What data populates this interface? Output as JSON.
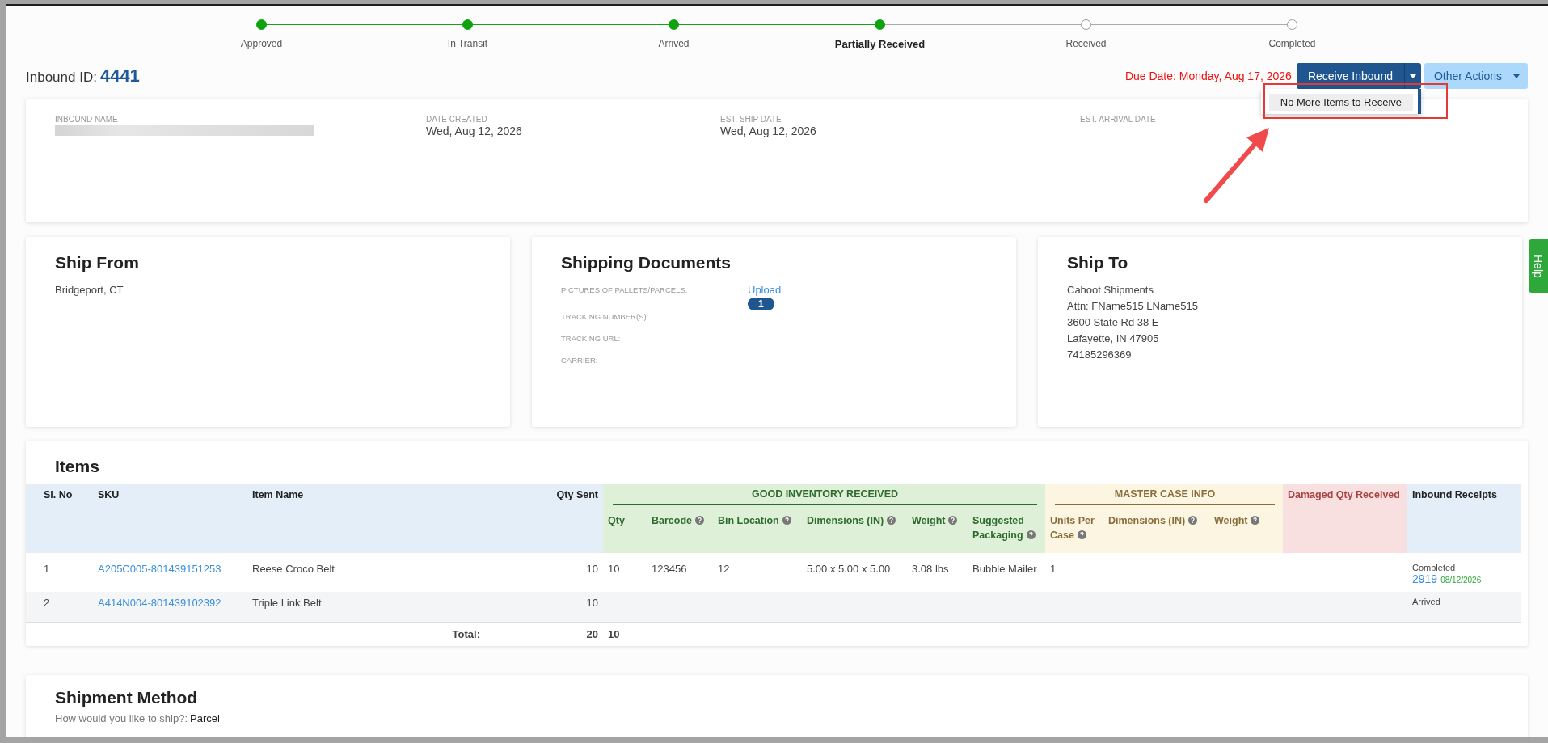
{
  "steps": [
    {
      "label": "Approved",
      "done": true,
      "selected": false
    },
    {
      "label": "In Transit",
      "done": true,
      "selected": false
    },
    {
      "label": "Arrived",
      "done": true,
      "selected": false
    },
    {
      "label": "Partially Received",
      "done": true,
      "selected": true
    },
    {
      "label": "Received",
      "done": false,
      "selected": false
    },
    {
      "label": "Completed",
      "done": false,
      "selected": false
    }
  ],
  "inbound": {
    "label": "Inbound ID:",
    "id": "4441"
  },
  "due_date": "Due Date: Monday, Aug 17, 2026",
  "receive_button": "Receive Inbound",
  "other_actions_button": "Other Actions",
  "dropdown_menu": {
    "items": [
      "No More Items to Receive"
    ]
  },
  "summary": {
    "fields": [
      {
        "label": "INBOUND NAME",
        "kind": "redacted"
      },
      {
        "label": "DATE CREATED",
        "kind": "text",
        "value": "Wed, Aug 12, 2026"
      },
      {
        "label": "EST. SHIP DATE",
        "kind": "text",
        "value": "Wed, Aug 12, 2026"
      },
      {
        "label": "EST. ARRIVAL DATE",
        "kind": "text"
      }
    ]
  },
  "ship_from": {
    "title": "Ship From",
    "lines": [
      "Bridgeport, CT"
    ]
  },
  "shipping_documents": {
    "title": "Shipping Documents",
    "fields": [
      {
        "label": "PICTURES OF PALLETS/PARCELS:",
        "link": "Upload",
        "badge": "1"
      },
      {
        "label": "TRACKING NUMBER(S):"
      },
      {
        "label": "TRACKING URL:"
      },
      {
        "label": "CARRIER:"
      }
    ]
  },
  "ship_to": {
    "title": "Ship To",
    "lines": [
      "Cahoot Shipments",
      "Attn: FName515 LName515",
      "3600 State Rd 38 E",
      "Lafayette, IN 47905",
      "74185296369"
    ]
  },
  "items": {
    "title": "Items",
    "header": [
      {
        "label": "Sl. No",
        "kind": "base"
      },
      {
        "label": "SKU",
        "kind": "base"
      },
      {
        "label": "Item Name",
        "kind": "base"
      },
      {
        "label": "Qty Sent",
        "kind": "base"
      },
      {
        "label": "GOOD INVENTORY RECEIVED",
        "kind": "good",
        "columns": [
          {
            "label": "Qty",
            "info": false
          },
          {
            "label": "Barcode",
            "info": true
          },
          {
            "label": "Bin Location",
            "info": true
          },
          {
            "label": "Dimensions (IN)",
            "info": true
          },
          {
            "label": "Weight",
            "info": true
          },
          {
            "label": "Suggested Packaging",
            "info": true
          }
        ]
      },
      {
        "label": "MASTER CASE INFO",
        "kind": "master",
        "columns": [
          {
            "label": "Units Per Case",
            "info": true
          },
          {
            "label": "Dimensions (IN)",
            "info": true
          },
          {
            "label": "Weight",
            "info": true
          }
        ]
      },
      {
        "label": "Damaged Qty Received",
        "kind": "damaged"
      },
      {
        "label": "Inbound Receipts",
        "kind": "receipts"
      }
    ],
    "rows": [
      {
        "cells": [
          "1",
          "A205C005-801439151253",
          "Reese Croco Belt",
          "10",
          "10",
          "123456",
          "12",
          "5.00 x 5.00 x 5.00",
          "3.08 lbs",
          "Bubble Mailer",
          "1",
          null,
          null,
          null
        ],
        "receipt": {
          "status": "Completed",
          "link": "2919",
          "date": "08/12/2026"
        }
      },
      {
        "cells": [
          "2",
          "A414N004-801439102392",
          "Triple Link Belt",
          "10",
          null,
          null,
          null,
          null,
          null,
          null,
          null,
          null,
          null,
          null
        ],
        "receipt": {
          "status": "Arrived"
        }
      }
    ],
    "total": {
      "label": "Total:",
      "qty_sent": "20",
      "qty": "10"
    }
  },
  "shipment_method": {
    "title": "Shipment Method",
    "question": "How would you like to ship?:",
    "answer": "Parcel"
  },
  "help_tab": "Help"
}
